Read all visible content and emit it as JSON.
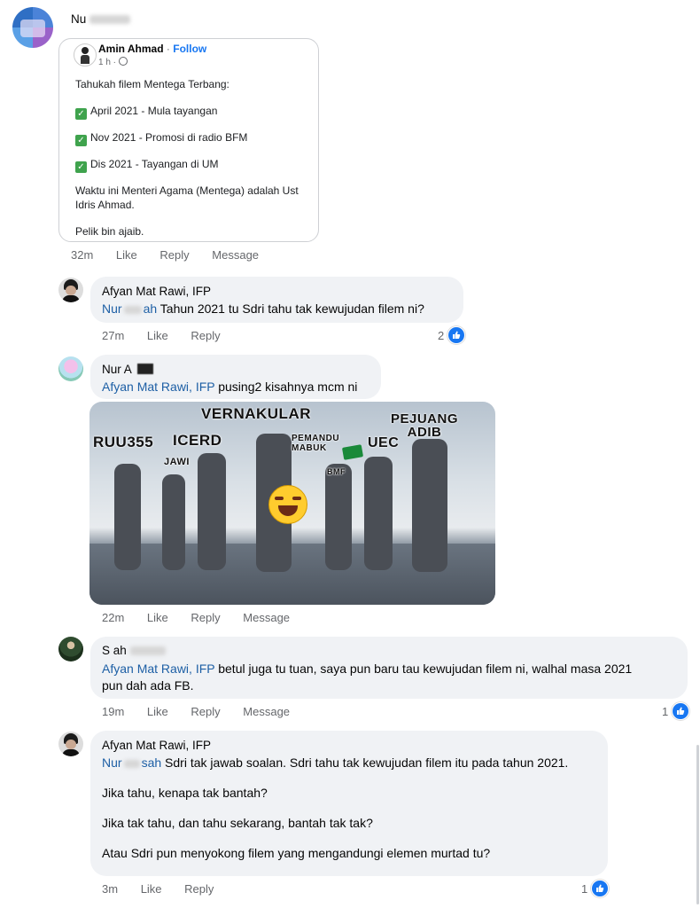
{
  "top_comment": {
    "name": "Nu",
    "share_card": {
      "author": "Amin Ahmad",
      "follow": "Follow",
      "time": "1 h ·",
      "lines": [
        "Tahukah filem Mentega Terbang:",
        "April 2021 - Mula tayangan",
        "Nov 2021 - Promosi di radio BFM",
        "Dis 2021 - Tayangan di UM",
        "Waktu ini Menteri Agama (Mentega) adalah Ust",
        "Idris Ahmad.",
        "Pelik bin ajaib."
      ]
    },
    "actions": {
      "time": "32m",
      "like": "Like",
      "reply": "Reply",
      "message": "Message"
    }
  },
  "comments": [
    {
      "name": "Afyan Mat Rawi, IFP",
      "mention": "Nur",
      "mention_tail": "ah",
      "text": "Tahun 2021 tu Sdri tahu tak kewujudan filem ni?",
      "actions": {
        "time": "27m",
        "like": "Like",
        "reply": "Reply"
      },
      "reactions": "2"
    },
    {
      "name": "Nur A",
      "mention": "Afyan Mat Rawi, IFP",
      "text": "pusing2 kisahnya mcm ni",
      "actions": {
        "time": "22m",
        "like": "Like",
        "reply": "Reply",
        "message": "Message"
      },
      "meme_labels": {
        "vernakular": "VERNAKULAR",
        "pejuang_adib": "PEJUANG ADIB",
        "ruu355": "RUU355",
        "icerd": "ICERD",
        "pemandu": "PEMANDU MABUK",
        "uec": "UEC",
        "jawi": "JAWI",
        "bmf": "BMF"
      }
    },
    {
      "name": "S  ah",
      "mention": "Afyan Mat Rawi, IFP",
      "text": "betul juga tu tuan, saya pun baru tau kewujudan filem ni, walhal masa 2021",
      "text2": "pun dah ada FB.",
      "actions": {
        "time": "19m",
        "like": "Like",
        "reply": "Reply",
        "message": "Message"
      },
      "reactions": "1"
    },
    {
      "name": "Afyan Mat Rawi, IFP",
      "mention": "Nur",
      "mention_tail": "sah",
      "text": "Sdri tak jawab soalan. Sdri tahu tak kewujudan filem itu pada tahun 2021.",
      "para2": "Jika tahu, kenapa tak bantah?",
      "para3": "Jika tak tahu, dan tahu sekarang, bantah tak tak?",
      "para4": "Atau Sdri pun menyokong filem yang mengandungi elemen murtad tu?",
      "actions": {
        "time": "3m",
        "like": "Like",
        "reply": "Reply"
      },
      "reactions": "1"
    }
  ],
  "colors": {
    "mention": "#1d5fa5",
    "bubble": "#f0f2f5",
    "like_blue": "#1877f2",
    "meta": "#65676b"
  }
}
